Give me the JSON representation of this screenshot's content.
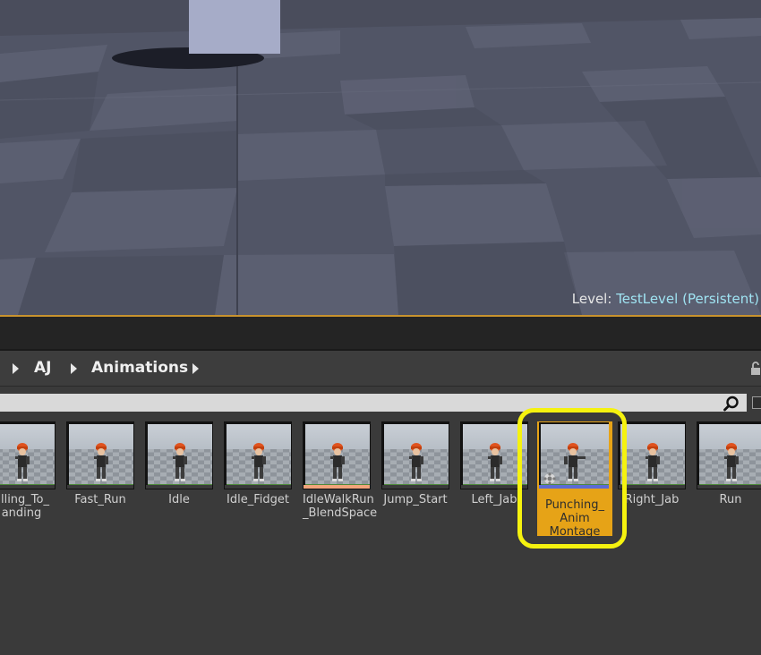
{
  "viewport": {
    "level_label": "Level:",
    "level_name": "TestLevel (Persistent)"
  },
  "breadcrumb": {
    "items": [
      {
        "label": "AJ"
      },
      {
        "label": "Animations"
      }
    ]
  },
  "search": {
    "value": "",
    "placeholder": ""
  },
  "assets": [
    {
      "label": "alling_To_\nanding",
      "accent": "#3a3a3a"
    },
    {
      "label": "Fast_Run",
      "accent": "#3a3a3a"
    },
    {
      "label": "Idle",
      "accent": "#3a3a3a"
    },
    {
      "label": "Idle_Fidget",
      "accent": "#3a3a3a"
    },
    {
      "label": "IdleWalkRun\n_BlendSpace",
      "accent": "#f2a47b"
    },
    {
      "label": "Jump_Start",
      "accent": "#3a3a3a"
    },
    {
      "label": "Left_Jab",
      "accent": "#3a3a3a"
    },
    {
      "label": "Punching_\nAnim\nMontage",
      "accent": "#5b6bd6",
      "selected": true
    },
    {
      "label": "Right_Jab",
      "accent": "#3a3a3a"
    },
    {
      "label": "Run",
      "accent": "#3a3a3a"
    }
  ],
  "colors": {
    "selection": "#e6a317",
    "highlight_ring": "#f5f20f",
    "level_name": "#9fe3f2"
  }
}
